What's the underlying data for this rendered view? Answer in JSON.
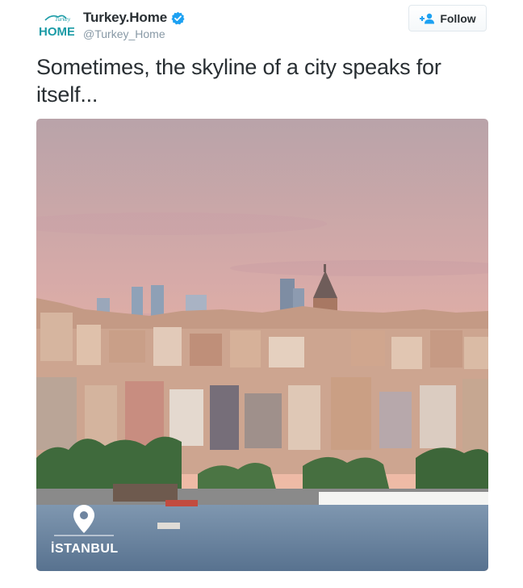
{
  "account": {
    "logo_text_top": "Turkey",
    "logo_text": "HOME",
    "display_name": "Turkey.Home",
    "handle": "@Turkey_Home",
    "verified": true,
    "brand_color": "#1a9ba6"
  },
  "actions": {
    "follow_label": "Follow",
    "follow_icon": "add-user-icon"
  },
  "tweet": {
    "text": "Sometimes, the skyline of a city speaks for itself..."
  },
  "media": {
    "caption": "İSTANBUL",
    "caption_icon": "location-pin-icon"
  },
  "colors": {
    "verified": "#1da1f2",
    "handle": "#8899a6",
    "text": "#292f33"
  }
}
